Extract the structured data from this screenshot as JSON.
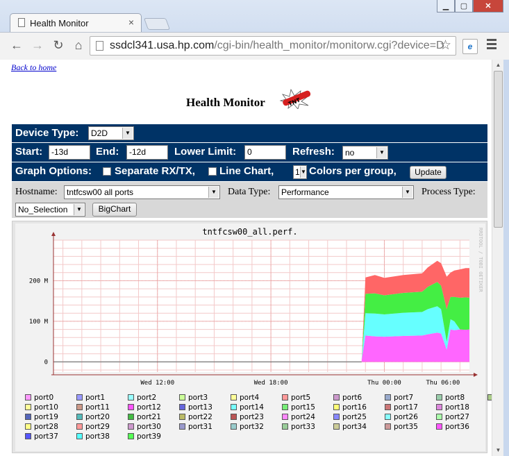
{
  "browser": {
    "tab_title": "Health Monitor",
    "url_host": "ssdcl341.usa.hp.com",
    "url_rest": "/cgi-bin/health_monitor/monitorw.cgi?device=D"
  },
  "page": {
    "back_link": "Back to home",
    "title": "Health Monitor",
    "device_type_label": "Device Type:",
    "device_type_value": "D2D",
    "start_label": "Start:",
    "start_value": "-13d",
    "end_label": "End:",
    "end_value": "-12d",
    "lower_limit_label": "Lower Limit:",
    "lower_limit_value": "0",
    "refresh_label": "Refresh:",
    "refresh_value": "no",
    "graph_options_label": "Graph Options:",
    "separate_label": "Separate RX/TX,",
    "line_chart_label": "Line Chart,",
    "colors_value": "1",
    "colors_label": "Colors per group,",
    "update_button": "Update",
    "hostname_label": "Hostname:",
    "hostname_value": "tntfcsw00 all ports",
    "data_type_label": "Data Type:",
    "data_type_value": "Performance",
    "process_type_label": "Process Type:",
    "process_value": "No_Selection",
    "bigchart_button": "BigChart"
  },
  "chart_data": {
    "type": "area",
    "title": "tntfcsw00_all.perf.",
    "watermark": "RRDTOOL / TOBI OETIKER",
    "y_ticks": [
      "0",
      "100 M",
      "200 M"
    ],
    "x_ticks": [
      "Wed 12:00",
      "Wed 18:00",
      "Thu 00:00",
      "Thu 06:00"
    ],
    "ylim": [
      -25000000,
      300000000
    ],
    "xlim": [
      6.5,
      28.5
    ],
    "stack_top_colors": [
      "#ff66ff",
      "#66ffff",
      "#44ee44",
      "#ff6666"
    ],
    "series": [
      {
        "name": "port36",
        "color": "#ff66ff",
        "x": [
          22.8,
          23.0,
          23.5,
          24.0,
          25.0,
          26.0,
          26.3,
          26.8,
          27.0,
          27.3,
          27.5,
          27.7,
          28.0,
          28.3,
          28.5
        ],
        "values": [
          5000000,
          65000000,
          63000000,
          62000000,
          64000000,
          65000000,
          68000000,
          72000000,
          70000000,
          30000000,
          80000000,
          78000000,
          80000000,
          79000000,
          80000000
        ]
      },
      {
        "name": "port38",
        "color": "#66ffff",
        "x": [
          22.8,
          23.0,
          23.5,
          24.0,
          25.0,
          26.0,
          26.3,
          26.8,
          27.0,
          27.3,
          27.5,
          27.7,
          28.0,
          28.3,
          28.5
        ],
        "values": [
          0,
          55000000,
          56000000,
          55000000,
          57000000,
          58000000,
          62000000,
          65000000,
          60000000,
          20000000,
          25000000,
          22000000,
          0,
          0,
          0
        ]
      },
      {
        "name": "port39",
        "color": "#44ee44",
        "x": [
          22.8,
          23.0,
          23.5,
          24.0,
          25.0,
          26.0,
          26.3,
          26.8,
          27.0,
          27.3,
          27.5,
          27.7,
          28.0,
          28.3,
          28.5
        ],
        "values": [
          0,
          48000000,
          50000000,
          47000000,
          49000000,
          50000000,
          55000000,
          60000000,
          58000000,
          80000000,
          55000000,
          60000000,
          78000000,
          80000000,
          78000000
        ]
      },
      {
        "name": "port37",
        "color": "#ff6666",
        "x": [
          22.8,
          23.0,
          23.5,
          24.0,
          25.0,
          26.0,
          26.3,
          26.8,
          27.0,
          27.3,
          27.5,
          27.7,
          28.0,
          28.3,
          28.5
        ],
        "values": [
          0,
          40000000,
          45000000,
          43000000,
          44000000,
          45000000,
          48000000,
          52000000,
          55000000,
          80000000,
          60000000,
          65000000,
          70000000,
          72000000,
          73000000
        ]
      }
    ],
    "legend": [
      {
        "name": "port0",
        "color": "#ff99ff"
      },
      {
        "name": "port1",
        "color": "#9999ff"
      },
      {
        "name": "port2",
        "color": "#99ffff"
      },
      {
        "name": "port3",
        "color": "#ccff99"
      },
      {
        "name": "port4",
        "color": "#ffff99"
      },
      {
        "name": "port5",
        "color": "#ff9999"
      },
      {
        "name": "port6",
        "color": "#cc99cc"
      },
      {
        "name": "port7",
        "color": "#99aacc"
      },
      {
        "name": "port8",
        "color": "#99ccaa"
      },
      {
        "name": "port9",
        "color": "#aacc88"
      },
      {
        "name": "port10",
        "color": "#ffff99"
      },
      {
        "name": "port11",
        "color": "#cc9988"
      },
      {
        "name": "port12",
        "color": "#ff55ff"
      },
      {
        "name": "port13",
        "color": "#6666dd"
      },
      {
        "name": "port14",
        "color": "#77ffff"
      },
      {
        "name": "port15",
        "color": "#77ee77"
      },
      {
        "name": "port16",
        "color": "#ffff77"
      },
      {
        "name": "port17",
        "color": "#cc7777"
      },
      {
        "name": "port18",
        "color": "#dd88dd"
      },
      {
        "name": "port19",
        "color": "#5566bb"
      },
      {
        "name": "port20",
        "color": "#55bbbb"
      },
      {
        "name": "port21",
        "color": "#44bb44"
      },
      {
        "name": "port22",
        "color": "#bbbb66"
      },
      {
        "name": "port23",
        "color": "#bb5555"
      },
      {
        "name": "port24",
        "color": "#ff88ff"
      },
      {
        "name": "port25",
        "color": "#8888ff"
      },
      {
        "name": "port26",
        "color": "#88ffff"
      },
      {
        "name": "port27",
        "color": "#aaffaa"
      },
      {
        "name": "port28",
        "color": "#ffff88"
      },
      {
        "name": "port29",
        "color": "#ff9999"
      },
      {
        "name": "port30",
        "color": "#cc99cc"
      },
      {
        "name": "port31",
        "color": "#9999cc"
      },
      {
        "name": "port32",
        "color": "#99cccc"
      },
      {
        "name": "port33",
        "color": "#99cc99"
      },
      {
        "name": "port34",
        "color": "#cccc99"
      },
      {
        "name": "port35",
        "color": "#cc9999"
      },
      {
        "name": "port36",
        "color": "#ff55ff"
      },
      {
        "name": "port37",
        "color": "#5555ff"
      },
      {
        "name": "port38",
        "color": "#55ffff"
      },
      {
        "name": "port39",
        "color": "#55ff55"
      }
    ]
  }
}
